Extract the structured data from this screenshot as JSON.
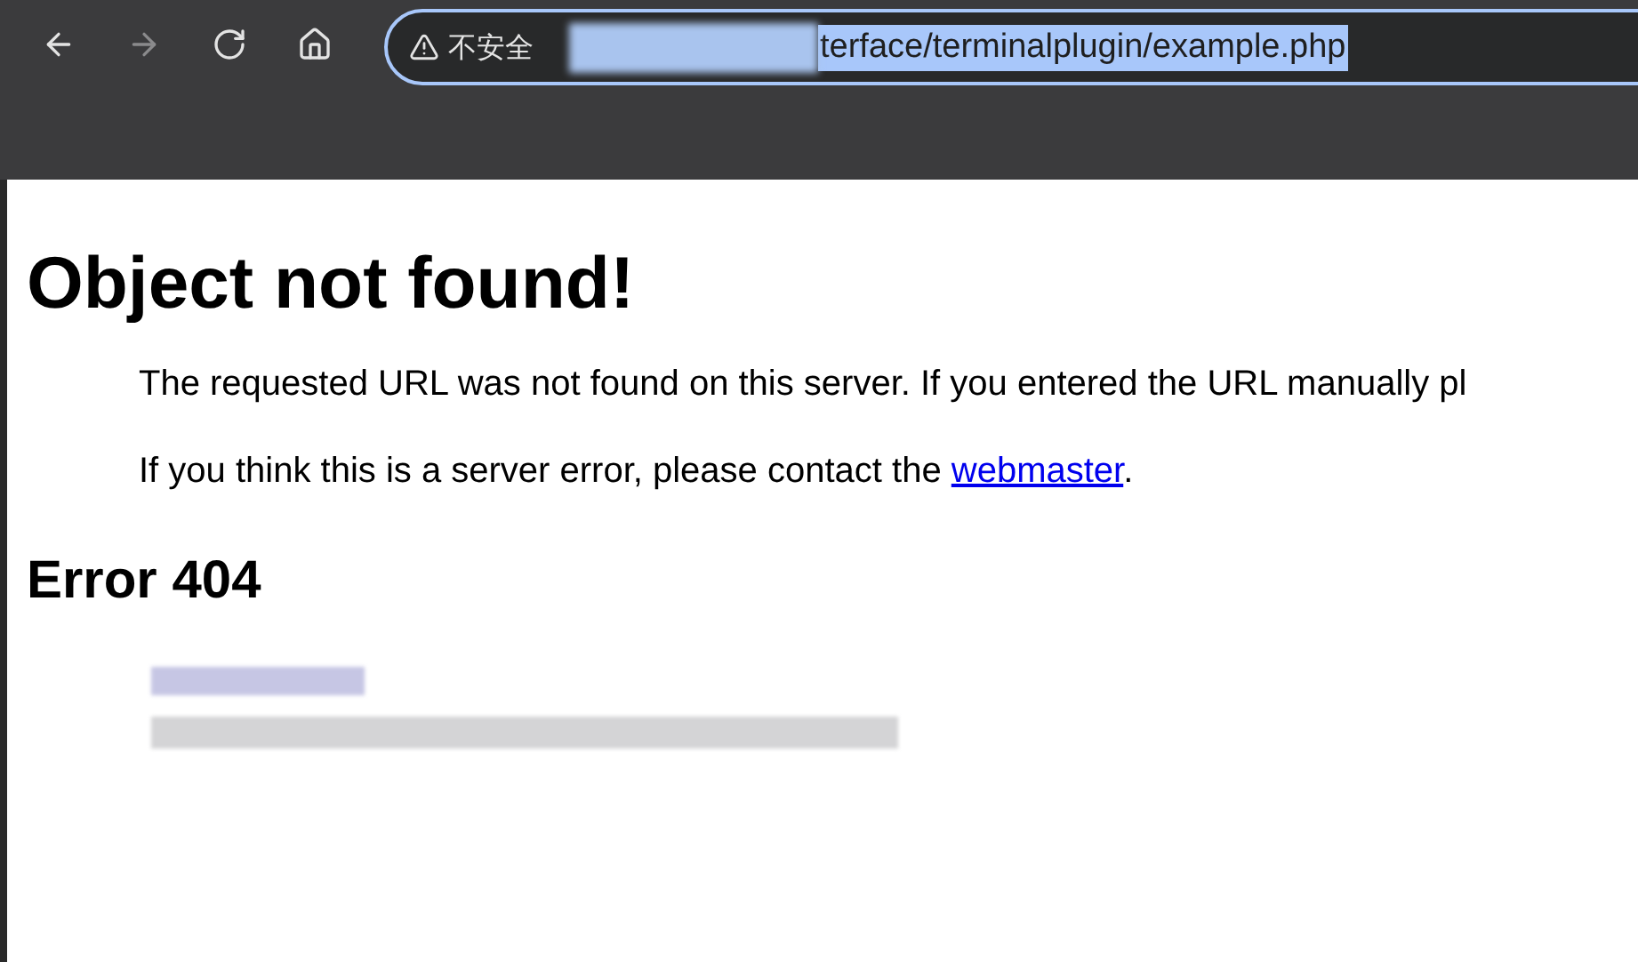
{
  "toolbar": {
    "buttons": [
      {
        "kind": "back",
        "disabled": false
      },
      {
        "kind": "forward",
        "disabled": true
      },
      {
        "kind": "reload",
        "disabled": false
      },
      {
        "kind": "home",
        "disabled": false
      }
    ]
  },
  "address_bar": {
    "security_label": "不安全",
    "url": "terface/terminalplugin/example.php",
    "selected": true
  },
  "page": {
    "title": "Object not found!",
    "paragraphs": [
      {
        "before": "The requested URL was not found on this server. If you entered the URL manually pl"
      },
      {
        "before": "If you think this is a server error, please contact the ",
        "link": "webmaster",
        "after": "."
      }
    ],
    "error_heading": "Error 404"
  }
}
